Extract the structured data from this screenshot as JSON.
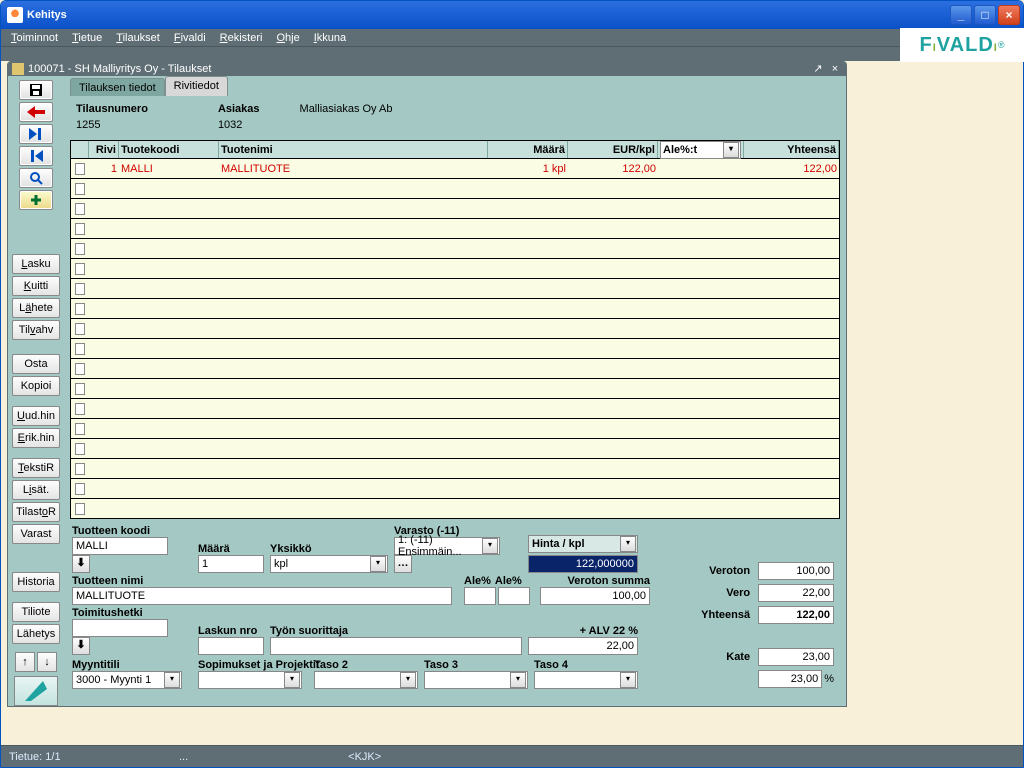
{
  "window": {
    "title": "Kehitys"
  },
  "menu": {
    "items": [
      "Toiminnot",
      "Tietue",
      "Tilaukset",
      "Fivaldi",
      "Rekisteri",
      "Ohje",
      "Ikkuna"
    ],
    "underlines": [
      "T",
      "T",
      "T",
      "F",
      "R",
      "O",
      "I"
    ]
  },
  "branding": "FIVALDI",
  "inner": {
    "title": "100071 - SH Malliyritys Oy - Tilaukset"
  },
  "tabs": {
    "inactive": "Tilauksen tiedot",
    "active": "Rivitiedot"
  },
  "header": {
    "tilausnumero_lbl": "Tilausnumero",
    "tilausnumero": "1255",
    "asiakas_lbl": "Asiakas",
    "asiakas": "1032",
    "asiakas_nimi": "Malliasiakas Oy Ab"
  },
  "gridHeaders": {
    "rivi": "Rivi",
    "tuotekoodi": "Tuotekoodi",
    "tuotenimi": "Tuotenimi",
    "maara": "Määrä",
    "eurkpl": "EUR/kpl",
    "ale": "Ale%:t",
    "yhteensa": "Yhteensä"
  },
  "gridRow": {
    "rivi": "1",
    "tuotekoodi": "MALLI",
    "tuotenimi": "MALLITUOTE",
    "maara": "1  kpl",
    "eurkpl": "122,00",
    "yhteensa": "122,00"
  },
  "sideButtons": {
    "lasku": "Lasku",
    "kuitti": "Kuitti",
    "lahete": "Lähete",
    "tilvahv": "Tilvahv",
    "osta": "Osta",
    "kopioi": "Kopioi",
    "uudhin": "Uud.hin",
    "erikhin": "Erik.hin",
    "tekstir": "TekstiR",
    "lisat": "Lisät.",
    "tilastor": "TilastoR",
    "varast": "Varast",
    "historia": "Historia",
    "tiliote": "Tiliote",
    "lahetys": "Lähetys"
  },
  "form": {
    "tuotteen_koodi_lbl": "Tuotteen koodi",
    "tuotteen_koodi": "MALLI",
    "maara_lbl": "Määrä",
    "maara": "1",
    "yksikko_lbl": "Yksikkö",
    "yksikko": "kpl",
    "varasto_lbl": "Varasto (-11)",
    "varasto": "1: (-11) Ensimmäin...",
    "hinta_lbl": "Hinta / kpl",
    "hinta_sel": "122,000000",
    "tuotteen_nimi_lbl": "Tuotteen nimi",
    "tuotteen_nimi": "MALLITUOTE",
    "alep_lbl": "Ale%",
    "alep2_lbl": "Ale%",
    "veroton_summa_lbl": "Veroton summa",
    "veroton_summa": "100,00",
    "toimitushetki_lbl": "Toimitushetki",
    "laskun_nro_lbl": "Laskun nro",
    "tyon_suor_lbl": "Työn suorittaja",
    "alv_lbl": "+ ALV  22 %",
    "alv_val": "22,00",
    "myyntitili_lbl": "Myyntitili",
    "myyntitili": "3000 - Myynti 1",
    "sopimukset_lbl": "Sopimukset ja Projektit",
    "taso2_lbl": "Taso 2",
    "taso3_lbl": "Taso 3",
    "taso4_lbl": "Taso 4"
  },
  "totals": {
    "veroton_lbl": "Veroton",
    "veroton": "100,00",
    "vero_lbl": "Vero",
    "vero": "22,00",
    "yhteensa_lbl": "Yhteensä",
    "yhteensa": "122,00",
    "kate_lbl": "Kate",
    "kate": "23,00",
    "kate_pct": "23,00",
    "pct_sym": "%"
  },
  "status": {
    "tietue": "Tietue: 1/1",
    "dots": "...",
    "kjk": "<KJK>"
  }
}
